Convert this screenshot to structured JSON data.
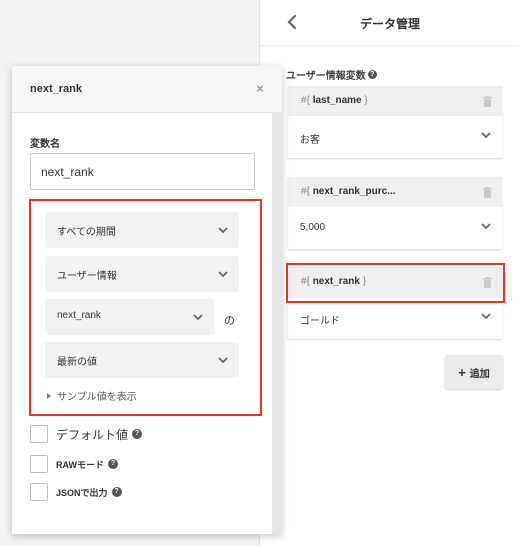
{
  "right_panel": {
    "title": "データ管理",
    "section_label": "ユーザー情報変数",
    "variables": [
      {
        "prefix": "#{",
        "name": "last_name",
        "suffix": "}",
        "value": "お客"
      },
      {
        "prefix": "#{",
        "name": "next_rank_purc...",
        "suffix": "",
        "value": "5,000"
      },
      {
        "prefix": "#{",
        "name": "next_rank",
        "suffix": "}",
        "value": "ゴールド"
      }
    ],
    "add_label": "追加"
  },
  "modal": {
    "title": "next_rank",
    "field_label": "変数名",
    "name_value": "next_rank",
    "period": "すべての期間",
    "source": "ユーザー情報",
    "attribute": "next_rank",
    "no_particle": "の",
    "aggregation": "最新の値",
    "sample_link": "サンプル値を表示",
    "default_label": "デフォルト値",
    "raw_label": "RAWモード",
    "json_label": "JSONで出力"
  },
  "accent_color": "#e8361c"
}
